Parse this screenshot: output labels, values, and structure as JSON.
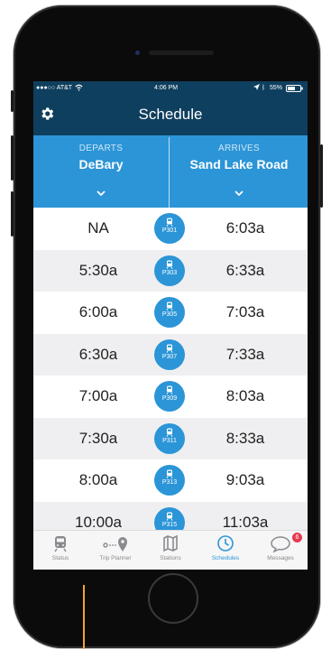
{
  "status_bar": {
    "carrier": "●●●○○ AT&T",
    "time": "4:06 PM",
    "battery": "55%"
  },
  "nav": {
    "title": "Schedule",
    "settings_icon": "gear-icon"
  },
  "route": {
    "departs_caption": "DEPARTS",
    "departs_station": "DeBary",
    "arrives_caption": "ARRIVES",
    "arrives_station": "Sand Lake Road"
  },
  "schedule": [
    {
      "depart": "NA",
      "train": "P301",
      "arrive": "6:03a"
    },
    {
      "depart": "5:30a",
      "train": "P303",
      "arrive": "6:33a"
    },
    {
      "depart": "6:00a",
      "train": "P305",
      "arrive": "7:03a"
    },
    {
      "depart": "6:30a",
      "train": "P307",
      "arrive": "7:33a"
    },
    {
      "depart": "7:00a",
      "train": "P309",
      "arrive": "8:03a"
    },
    {
      "depart": "7:30a",
      "train": "P311",
      "arrive": "8:33a"
    },
    {
      "depart": "8:00a",
      "train": "P313",
      "arrive": "9:03a"
    },
    {
      "depart": "10:00a",
      "train": "P315",
      "arrive": "11:03a"
    }
  ],
  "tabs": [
    {
      "label": "Status",
      "icon": "train-icon"
    },
    {
      "label": "Trip Planner",
      "icon": "route-pin-icon"
    },
    {
      "label": "Stations",
      "icon": "map-icon"
    },
    {
      "label": "Schedules",
      "icon": "clock-icon",
      "active": true
    },
    {
      "label": "Messages",
      "icon": "chat-bubble-icon",
      "badge": "6"
    }
  ],
  "colors": {
    "navbar": "#0f3f5e",
    "accent": "#2b95d7",
    "alt_row": "#efeff1",
    "badge_red": "#e53a4f"
  }
}
